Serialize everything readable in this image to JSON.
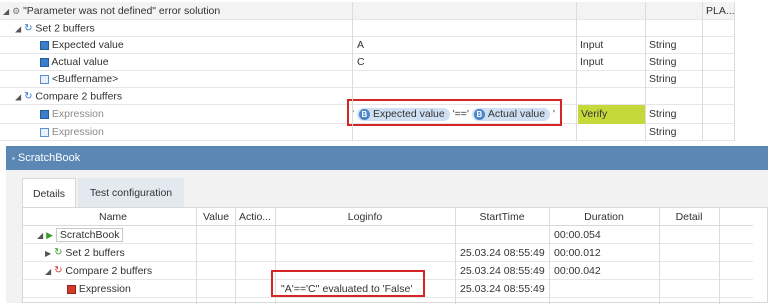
{
  "top": {
    "title": "\"Parameter was not defined\" error solution",
    "pla_header": "PLA...",
    "set_group": "Set 2 buffers",
    "rows": [
      {
        "name": "Expected value",
        "value": "A",
        "type": "Input",
        "datatype": "String"
      },
      {
        "name": "Actual value",
        "value": "C",
        "type": "Input",
        "datatype": "String"
      },
      {
        "name": "<Buffername>",
        "value": "",
        "type": "",
        "datatype": "String"
      }
    ],
    "compare_group": "Compare 2 buffers",
    "expression_row": {
      "name": "Expression",
      "quote_open": "'",
      "pill1_icon": "B",
      "pill1": "Expected value",
      "operator": "'=='",
      "pill2_icon": "B",
      "pill2": "Actual value",
      "quote_close": "'",
      "type": "Verify",
      "datatype": "String"
    },
    "expression_row2": {
      "name": "Expression",
      "datatype": "String"
    }
  },
  "panel": {
    "title": "ScratchBook",
    "tabs": [
      "Details",
      "Test configuration"
    ],
    "columns": [
      "Name",
      "Value",
      "Actio...",
      "Loginfo",
      "StartTime",
      "Duration",
      "Detail"
    ],
    "rows": [
      {
        "name": "ScratchBook",
        "loginfo": "",
        "start": "",
        "duration": "00:00.054"
      },
      {
        "name": "Set 2 buffers",
        "loginfo": "",
        "start": "25.03.24 08:55:49",
        "duration": "00:00.012"
      },
      {
        "name": "Compare 2 buffers",
        "loginfo": "",
        "start": "25.03.24 08:55:49",
        "duration": "00:00.042"
      },
      {
        "name": "Expression",
        "loginfo": "\"A'=='C'' evaluated to 'False'",
        "start": "25.03.24 08:55:49",
        "duration": ""
      }
    ]
  },
  "colors": {
    "verify": "#c6d93a",
    "panel_header": "#5b87b4",
    "highlight": "#d62525",
    "tab_bg": "#e4e9ef"
  }
}
